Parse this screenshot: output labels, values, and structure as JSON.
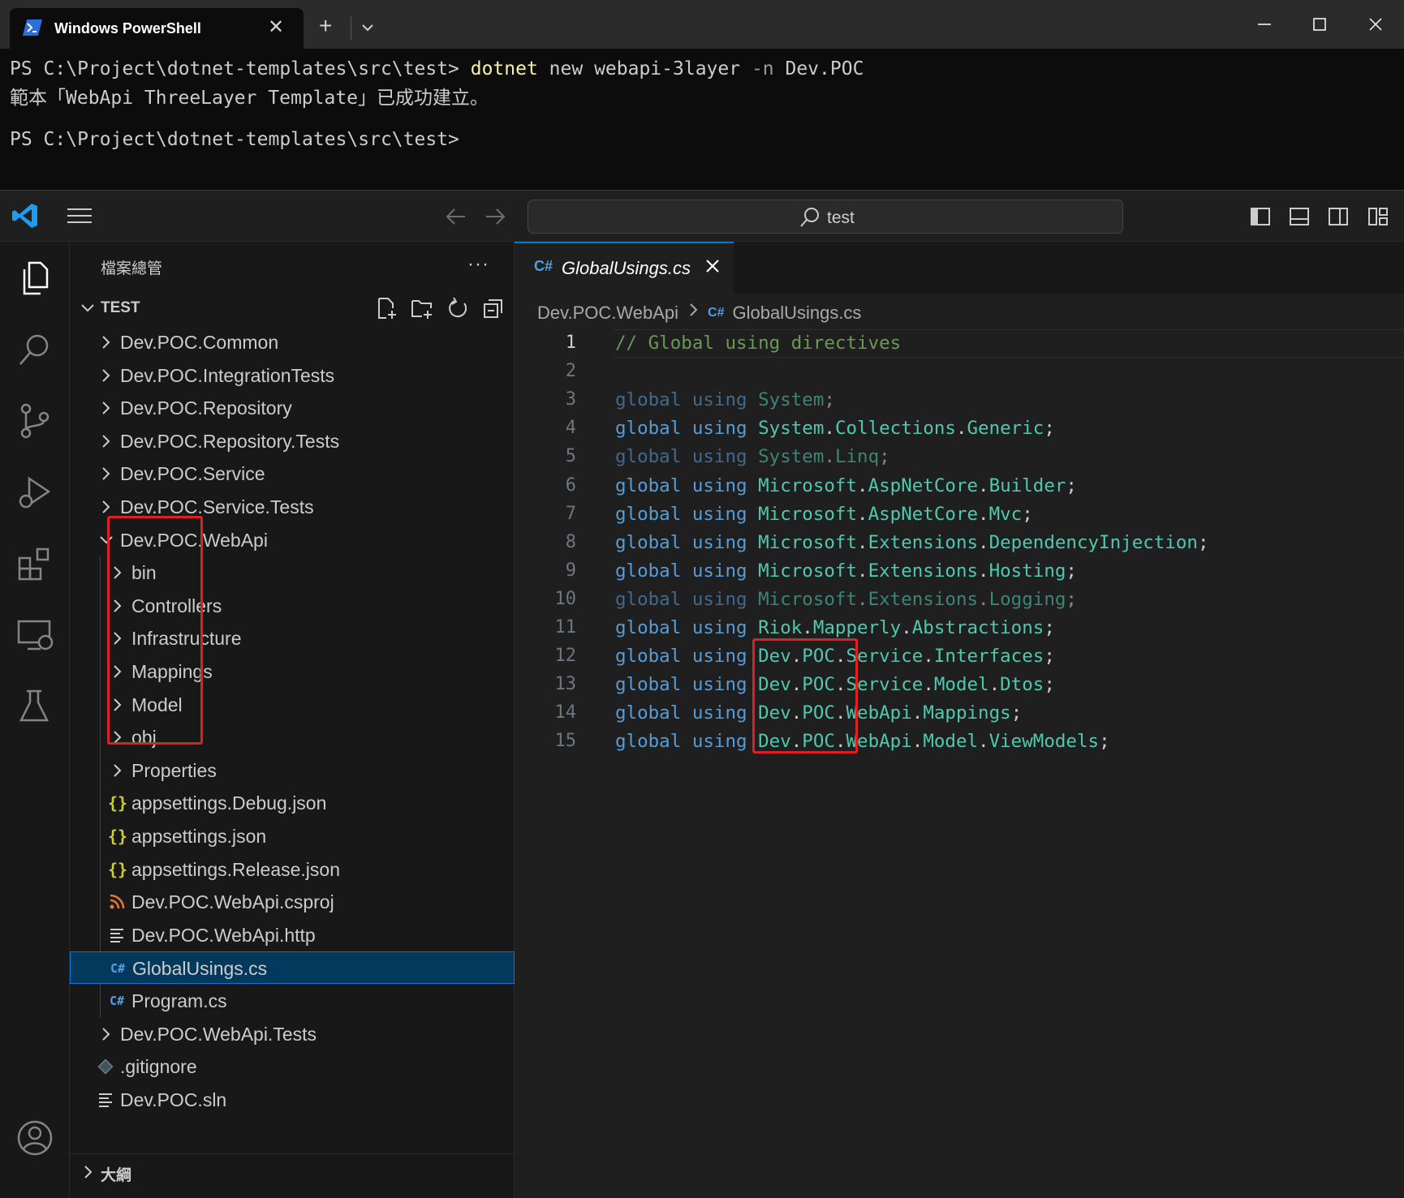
{
  "powershell": {
    "tab_title": "Windows PowerShell",
    "terminal": {
      "line1_prompt": "PS C:\\Project\\dotnet-templates\\src\\test> ",
      "line1_cmd": "dotnet",
      "line1_args": " new webapi-3layer ",
      "line1_flag": "-n",
      "line1_value": " Dev.POC",
      "line2": "範本「WebApi ThreeLayer Template」已成功建立。",
      "line3_prompt": "PS C:\\Project\\dotnet-templates\\src\\test>"
    }
  },
  "vscode": {
    "search_text": "test",
    "sidebar": {
      "title": "檔案總管",
      "more": "···",
      "section": "TEST",
      "outline": "大綱"
    },
    "tree": [
      {
        "name": "Dev.POC.Common",
        "type": "folder",
        "depth": 0,
        "expanded": false
      },
      {
        "name": "Dev.POC.IntegrationTests",
        "type": "folder",
        "depth": 0,
        "expanded": false
      },
      {
        "name": "Dev.POC.Repository",
        "type": "folder",
        "depth": 0,
        "expanded": false
      },
      {
        "name": "Dev.POC.Repository.Tests",
        "type": "folder",
        "depth": 0,
        "expanded": false
      },
      {
        "name": "Dev.POC.Service",
        "type": "folder",
        "depth": 0,
        "expanded": false
      },
      {
        "name": "Dev.POC.Service.Tests",
        "type": "folder",
        "depth": 0,
        "expanded": false
      },
      {
        "name": "Dev.POC.WebApi",
        "type": "folder",
        "depth": 0,
        "expanded": true
      },
      {
        "name": "bin",
        "type": "folder",
        "depth": 1,
        "expanded": false
      },
      {
        "name": "Controllers",
        "type": "folder",
        "depth": 1,
        "expanded": false
      },
      {
        "name": "Infrastructure",
        "type": "folder",
        "depth": 1,
        "expanded": false
      },
      {
        "name": "Mappings",
        "type": "folder",
        "depth": 1,
        "expanded": false
      },
      {
        "name": "Model",
        "type": "folder",
        "depth": 1,
        "expanded": false
      },
      {
        "name": "obj",
        "type": "folder",
        "depth": 1,
        "expanded": false
      },
      {
        "name": "Properties",
        "type": "folder",
        "depth": 1,
        "expanded": false
      },
      {
        "name": "appsettings.Debug.json",
        "type": "json",
        "depth": 1,
        "icon": "{}"
      },
      {
        "name": "appsettings.json",
        "type": "json",
        "depth": 1,
        "icon": "{}"
      },
      {
        "name": "appsettings.Release.json",
        "type": "json",
        "depth": 1,
        "icon": "{}"
      },
      {
        "name": "Dev.POC.WebApi.csproj",
        "type": "rss",
        "depth": 1
      },
      {
        "name": "Dev.POC.WebApi.http",
        "type": "lines",
        "depth": 1
      },
      {
        "name": "GlobalUsings.cs",
        "type": "cs",
        "depth": 1,
        "icon": "C#",
        "selected": true
      },
      {
        "name": "Program.cs",
        "type": "cs",
        "depth": 1,
        "icon": "C#"
      },
      {
        "name": "Dev.POC.WebApi.Tests",
        "type": "folder",
        "depth": 0,
        "expanded": false
      },
      {
        "name": ".gitignore",
        "type": "git",
        "depth": 0
      },
      {
        "name": "Dev.POC.sln",
        "type": "lines",
        "depth": 0
      }
    ],
    "editor": {
      "tab_icon": "C#",
      "tab_label": "GlobalUsings.cs",
      "breadcrumb_folder": "Dev.POC.WebApi",
      "breadcrumb_icon": "C#",
      "breadcrumb_file": "GlobalUsings.cs",
      "lines": [
        {
          "n": "1",
          "parts": [
            [
              "cm",
              "// Global using directives"
            ]
          ]
        },
        {
          "n": "2",
          "parts": []
        },
        {
          "n": "3",
          "dim": true,
          "parts": [
            [
              "kw",
              "global"
            ],
            [
              "",
              " "
            ],
            [
              "kw",
              "using"
            ],
            [
              "",
              " "
            ],
            [
              "ns",
              "System"
            ],
            [
              "",
              ";"
            ]
          ]
        },
        {
          "n": "4",
          "parts": [
            [
              "kw",
              "global"
            ],
            [
              "",
              " "
            ],
            [
              "kw",
              "using"
            ],
            [
              "",
              " "
            ],
            [
              "ns",
              "System"
            ],
            [
              "",
              "."
            ],
            [
              "ns",
              "Collections"
            ],
            [
              "",
              "."
            ],
            [
              "ns",
              "Generic"
            ],
            [
              "",
              ";"
            ]
          ]
        },
        {
          "n": "5",
          "dim": true,
          "parts": [
            [
              "kw",
              "global"
            ],
            [
              "",
              " "
            ],
            [
              "kw",
              "using"
            ],
            [
              "",
              " "
            ],
            [
              "ns",
              "System"
            ],
            [
              "",
              "."
            ],
            [
              "ns",
              "Linq"
            ],
            [
              "",
              ";"
            ]
          ]
        },
        {
          "n": "6",
          "parts": [
            [
              "kw",
              "global"
            ],
            [
              "",
              " "
            ],
            [
              "kw",
              "using"
            ],
            [
              "",
              " "
            ],
            [
              "ns",
              "Microsoft"
            ],
            [
              "",
              "."
            ],
            [
              "ns",
              "AspNetCore"
            ],
            [
              "",
              "."
            ],
            [
              "ns",
              "Builder"
            ],
            [
              "",
              ";"
            ]
          ]
        },
        {
          "n": "7",
          "parts": [
            [
              "kw",
              "global"
            ],
            [
              "",
              " "
            ],
            [
              "kw",
              "using"
            ],
            [
              "",
              " "
            ],
            [
              "ns",
              "Microsoft"
            ],
            [
              "",
              "."
            ],
            [
              "ns",
              "AspNetCore"
            ],
            [
              "",
              "."
            ],
            [
              "ns",
              "Mvc"
            ],
            [
              "",
              ";"
            ]
          ]
        },
        {
          "n": "8",
          "parts": [
            [
              "kw",
              "global"
            ],
            [
              "",
              " "
            ],
            [
              "kw",
              "using"
            ],
            [
              "",
              " "
            ],
            [
              "ns",
              "Microsoft"
            ],
            [
              "",
              "."
            ],
            [
              "ns",
              "Extensions"
            ],
            [
              "",
              "."
            ],
            [
              "ns",
              "DependencyInjection"
            ],
            [
              "",
              ";"
            ]
          ]
        },
        {
          "n": "9",
          "parts": [
            [
              "kw",
              "global"
            ],
            [
              "",
              " "
            ],
            [
              "kw",
              "using"
            ],
            [
              "",
              " "
            ],
            [
              "ns",
              "Microsoft"
            ],
            [
              "",
              "."
            ],
            [
              "ns",
              "Extensions"
            ],
            [
              "",
              "."
            ],
            [
              "ns",
              "Hosting"
            ],
            [
              "",
              ";"
            ]
          ]
        },
        {
          "n": "10",
          "dim": true,
          "parts": [
            [
              "kw",
              "global"
            ],
            [
              "",
              " "
            ],
            [
              "kw",
              "using"
            ],
            [
              "",
              " "
            ],
            [
              "ns",
              "Microsoft"
            ],
            [
              "",
              "."
            ],
            [
              "ns",
              "Extensions"
            ],
            [
              "",
              "."
            ],
            [
              "ns",
              "Logging"
            ],
            [
              "",
              ";"
            ]
          ]
        },
        {
          "n": "11",
          "parts": [
            [
              "kw",
              "global"
            ],
            [
              "",
              " "
            ],
            [
              "kw",
              "using"
            ],
            [
              "",
              " "
            ],
            [
              "ns",
              "Riok"
            ],
            [
              "",
              "."
            ],
            [
              "ns",
              "Mapperly"
            ],
            [
              "",
              "."
            ],
            [
              "ns",
              "Abstractions"
            ],
            [
              "",
              ";"
            ]
          ]
        },
        {
          "n": "12",
          "parts": [
            [
              "kw",
              "global"
            ],
            [
              "",
              " "
            ],
            [
              "kw",
              "using"
            ],
            [
              "",
              " "
            ],
            [
              "ns",
              "Dev"
            ],
            [
              "",
              "."
            ],
            [
              "ns",
              "POC"
            ],
            [
              "",
              "."
            ],
            [
              "ns",
              "Service"
            ],
            [
              "",
              "."
            ],
            [
              "ns",
              "Interfaces"
            ],
            [
              "",
              ";"
            ]
          ]
        },
        {
          "n": "13",
          "parts": [
            [
              "kw",
              "global"
            ],
            [
              "",
              " "
            ],
            [
              "kw",
              "using"
            ],
            [
              "",
              " "
            ],
            [
              "ns",
              "Dev"
            ],
            [
              "",
              "."
            ],
            [
              "ns",
              "POC"
            ],
            [
              "",
              "."
            ],
            [
              "ns",
              "Service"
            ],
            [
              "",
              "."
            ],
            [
              "ns",
              "Model"
            ],
            [
              "",
              "."
            ],
            [
              "ns",
              "Dtos"
            ],
            [
              "",
              ";"
            ]
          ]
        },
        {
          "n": "14",
          "parts": [
            [
              "kw",
              "global"
            ],
            [
              "",
              " "
            ],
            [
              "kw",
              "using"
            ],
            [
              "",
              " "
            ],
            [
              "ns",
              "Dev"
            ],
            [
              "",
              "."
            ],
            [
              "ns",
              "POC"
            ],
            [
              "",
              "."
            ],
            [
              "ns",
              "WebApi"
            ],
            [
              "",
              "."
            ],
            [
              "ns",
              "Mappings"
            ],
            [
              "",
              ";"
            ]
          ]
        },
        {
          "n": "15",
          "parts": [
            [
              "kw",
              "global"
            ],
            [
              "",
              " "
            ],
            [
              "kw",
              "using"
            ],
            [
              "",
              " "
            ],
            [
              "ns",
              "Dev"
            ],
            [
              "",
              "."
            ],
            [
              "ns",
              "POC"
            ],
            [
              "",
              "."
            ],
            [
              "ns",
              "WebApi"
            ],
            [
              "",
              "."
            ],
            [
              "ns",
              "Model"
            ],
            [
              "",
              "."
            ],
            [
              "ns",
              "ViewModels"
            ],
            [
              "",
              ";"
            ]
          ]
        }
      ]
    },
    "colors": {
      "accent": "#0078d4",
      "highlight_box": "#e02020",
      "keyword": "#569cd6",
      "namespace": "#4ec9b0",
      "comment": "#6a9955",
      "json_icon": "#cbcb41",
      "rss_icon": "#e37933",
      "cs_icon": "#4fa0e6"
    }
  }
}
